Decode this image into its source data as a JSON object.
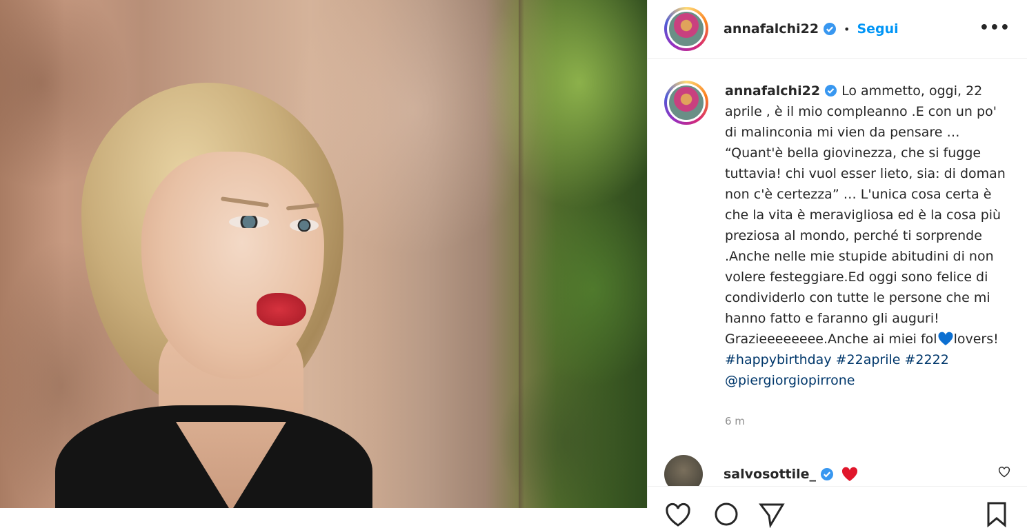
{
  "header": {
    "username": "annafalchi22",
    "separator": "•",
    "follow_label": "Segui",
    "more_label": "•••"
  },
  "caption": {
    "username": "annafalchi22",
    "text_before_heart": "Lo ammetto, oggi, 22 aprile , è il mio compleanno .E con un po' di malinconia mi vien da pensare … “Quant'è bella giovinezza, che si fugge tuttavia! chi vuol esser lieto, sia: di doman non c'è certezza” … L'unica cosa certa è che la vita è meravigliosa ed è la cosa più preziosa al mondo, perché ti sorprende .Anche nelle mie stupide abitudini di non volere festeggiare.Ed oggi sono felice di condividerlo con tutte le persone che mi hanno fatto e faranno gli auguri! Grazieeeeeeee.Anche ai miei fol",
    "text_after_heart": "lovers!",
    "hashtags": [
      "#happybirthday",
      "#22aprile",
      "#2222"
    ],
    "mention": "@piergiorgiopirrone",
    "timestamp": "6 m"
  },
  "comment": {
    "username": "salvosottile_"
  },
  "icons": {
    "verified": "verified-badge-icon",
    "blue_heart": "blue-heart-emoji",
    "red_heart": "red-heart-emoji",
    "like": "heart-outline-icon",
    "comment": "comment-icon",
    "share": "send-icon",
    "save": "bookmark-icon"
  },
  "colors": {
    "accent": "#0095f6",
    "link": "#00376b",
    "muted": "#8e8e8e",
    "verified": "#3897f0"
  }
}
